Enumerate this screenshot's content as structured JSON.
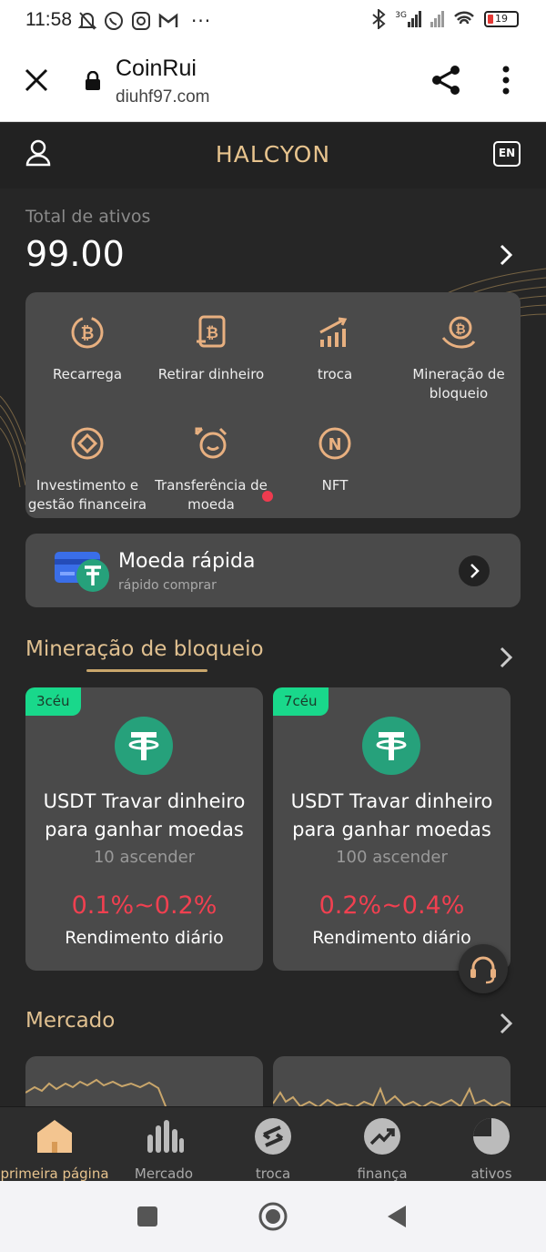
{
  "status_bar": {
    "time": "11:58",
    "network": "3G",
    "battery": "19"
  },
  "browser": {
    "title": "CoinRui",
    "url": "diuhf97.com"
  },
  "header": {
    "brand": "HALCYON",
    "lang": "EN"
  },
  "assets": {
    "label": "Total de ativos",
    "value": "99.00"
  },
  "menu": [
    {
      "label": "Recarrega",
      "icon": "bitcoin-cycle-icon"
    },
    {
      "label": "Retirar dinheiro",
      "icon": "bitcoin-document-icon"
    },
    {
      "label": "troca",
      "icon": "growth-chart-icon"
    },
    {
      "label": "Mineração de bloqueio",
      "icon": "bitcoin-hand-icon"
    },
    {
      "label": "Investimento e gestão financeira",
      "icon": "target-icon"
    },
    {
      "label": "Transferência de moeda",
      "icon": "transfer-icon"
    },
    {
      "label": "NFT",
      "icon": "nft-icon"
    }
  ],
  "quick_coin": {
    "title": "Moeda rápida",
    "subtitle": "rápido comprar"
  },
  "lock_mining": {
    "title": "Mineração de bloqueio",
    "cards": [
      {
        "tag": "3céu",
        "title": "USDT Travar dinheiro para ganhar moedas",
        "min": "10 ascender",
        "rate": "0.1%~0.2%",
        "rate_label": "Rendimento diário"
      },
      {
        "tag": "7céu",
        "title": "USDT Travar dinheiro para ganhar moedas",
        "min": "100 ascender",
        "rate": "0.2%~0.4%",
        "rate_label": "Rendimento diário"
      }
    ]
  },
  "market": {
    "title": "Mercado"
  },
  "bottom_nav": [
    {
      "label": "primeira página",
      "icon": "home-icon",
      "active": true
    },
    {
      "label": "Mercado",
      "icon": "bars-icon",
      "active": false
    },
    {
      "label": "troca",
      "icon": "exchange-icon",
      "active": false
    },
    {
      "label": "finança",
      "icon": "finance-icon",
      "active": false
    },
    {
      "label": "ativos",
      "icon": "pie-icon",
      "active": false
    }
  ],
  "colors": {
    "accent_gold": "#e8c48e",
    "tag_green": "#19d88b",
    "rate_red": "#f04050",
    "usdt_green": "#26a17b"
  }
}
